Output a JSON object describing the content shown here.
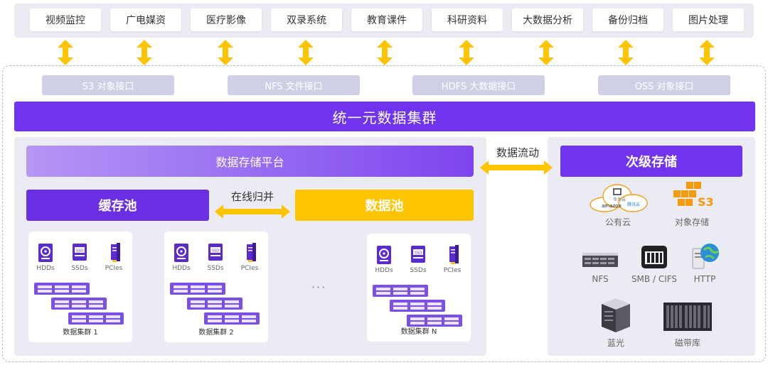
{
  "apps": [
    "视频监控",
    "广电媒资",
    "医疗影像",
    "双录系统",
    "教育课件",
    "科研资料",
    "大数据分析",
    "备份归档",
    "图片处理"
  ],
  "interfaces": [
    "S3 对象接口",
    "NFS 文件接口",
    "HDFS 大数据接口",
    "OSS 对象接口"
  ],
  "unified_cluster": "统一元数据集群",
  "storage_platform": "数据存储平台",
  "data_flow_label": "数据流动",
  "secondary_storage": "次级存储",
  "cache_pool": "缓存池",
  "online_merge_label": "在线归并",
  "data_pool": "数据池",
  "device_labels": [
    "HDDs",
    "SSDs",
    "PCIes"
  ],
  "clusters": [
    "数据集群 1",
    "数据集群 2",
    "数据集群 N"
  ],
  "ellipsis": "···",
  "cloud_badges": {
    "amazon": "amazon",
    "huawei": "华为云",
    "tencent": "腾讯云",
    "s3": "S3"
  },
  "secondary_items": [
    "公有云",
    "对象存储",
    "NFS",
    "SMB / CIFS",
    "HTTP",
    "蓝光",
    "磁带库"
  ],
  "colors": {
    "purple": "#7033ee",
    "yellow": "#ffc400",
    "panel": "#ebebf3",
    "interface": "#cfcfe6"
  }
}
